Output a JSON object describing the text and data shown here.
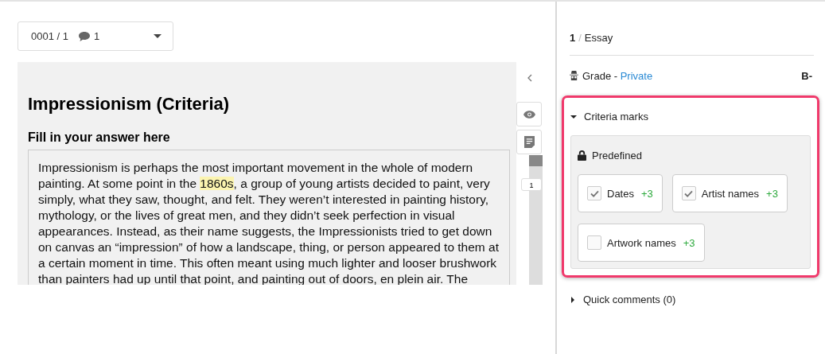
{
  "selector": {
    "page": "0001 / 1",
    "comments": "1"
  },
  "document": {
    "title": "Impressionism (Criteria)",
    "prompt": "Fill in your answer here",
    "answer_parts": [
      {
        "text": "Impressionism is perhaps the most important movement in the whole of modern painting. At some point in the ",
        "highlighted": false
      },
      {
        "text": "1860s",
        "highlighted": true
      },
      {
        "text": ", a group of young artists decided to paint, very simply, what they saw, thought, and felt. They weren’t interested in painting history, mythology, or the lives of great men, and they didn’t seek perfection in visual appearances. Instead, as their name suggests, the Impressionists tried to get down on canvas an “impression” of how a landscape, thing, or person appeared to them at a certain moment in time. This often meant using much lighter and looser brushwork than painters had up until that point, and painting out of doors, en plein air. The",
        "highlighted": false
      }
    ],
    "comment_marker": "1"
  },
  "grading": {
    "question_number": "1",
    "separator": "/",
    "question_type": "Essay",
    "grade_label": "Grade - ",
    "grade_visibility": "Private",
    "grade": "B-",
    "criteria": {
      "title": "Criteria marks",
      "expanded": true,
      "group": "Predefined",
      "items": [
        {
          "label": "Dates",
          "points": "+3",
          "checked": true
        },
        {
          "label": "Artist names",
          "points": "+3",
          "checked": true
        },
        {
          "label": "Artwork names",
          "points": "+3",
          "checked": false
        }
      ]
    },
    "quick_comments": {
      "title": "Quick comments (0)",
      "expanded": false
    }
  }
}
